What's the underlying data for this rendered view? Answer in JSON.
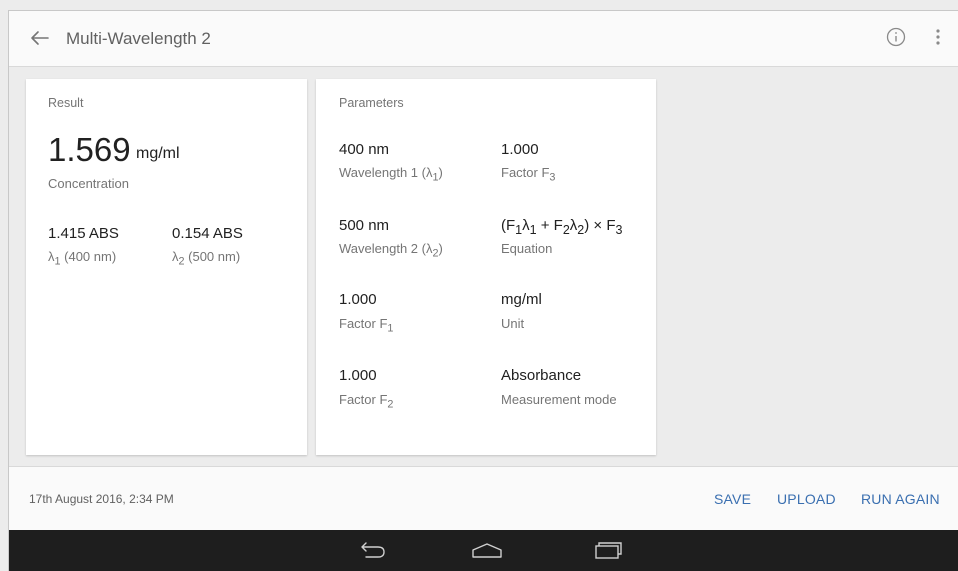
{
  "app": {
    "title": "Multi-Wavelength 2"
  },
  "result": {
    "section_label": "Result",
    "concentration_value": "1.569",
    "concentration_unit": "mg/ml",
    "concentration_label": "Concentration",
    "abs1_value": "1.415 ABS",
    "abs2_value": "0.154 ABS",
    "abs1_label_main": "λ",
    "abs1_label_sub": "1",
    "abs1_label_rest": " (400 nm)",
    "abs2_label_main": "λ",
    "abs2_label_sub": "2",
    "abs2_label_rest": " (500 nm)"
  },
  "parameters": {
    "section_label": "Parameters",
    "wl1_value": "400 nm",
    "wl1_label_main": "Wavelength 1 (λ",
    "wl1_label_sub": "1",
    "wl1_label_end": ")",
    "wl2_value": "500 nm",
    "wl2_label_main": "Wavelength 2 (λ",
    "wl2_label_sub": "2",
    "wl2_label_end": ")",
    "f1_value": "1.000",
    "f1_label_main": "Factor F",
    "f1_label_sub": "1",
    "f2_value": "1.000",
    "f2_label_main": "Factor F",
    "f2_label_sub": "2",
    "f3_value": "1.000",
    "f3_label_main": "Factor F",
    "f3_label_sub": "3",
    "equation_parts": [
      "(F",
      "1",
      "λ",
      "1",
      " + F",
      "2",
      "λ",
      "2",
      ") × F",
      "3"
    ],
    "equation_label": "Equation",
    "unit_value": "mg/ml",
    "unit_label": "Unit",
    "mode_value": "Absorbance",
    "mode_label": "Measurement mode"
  },
  "footer": {
    "timestamp": "17th August 2016, 2:34 PM",
    "save_label": "SAVE",
    "upload_label": "UPLOAD",
    "run_again_label": "RUN AGAIN"
  },
  "colors": {
    "accent": "#3a6fb0",
    "navbar": "#1e1e1e",
    "card": "#ffffff",
    "background": "#ececec"
  },
  "icons": [
    "back-arrow-icon",
    "info-icon",
    "more-vert-icon",
    "nav-back-icon",
    "nav-home-icon",
    "nav-recents-icon"
  ]
}
